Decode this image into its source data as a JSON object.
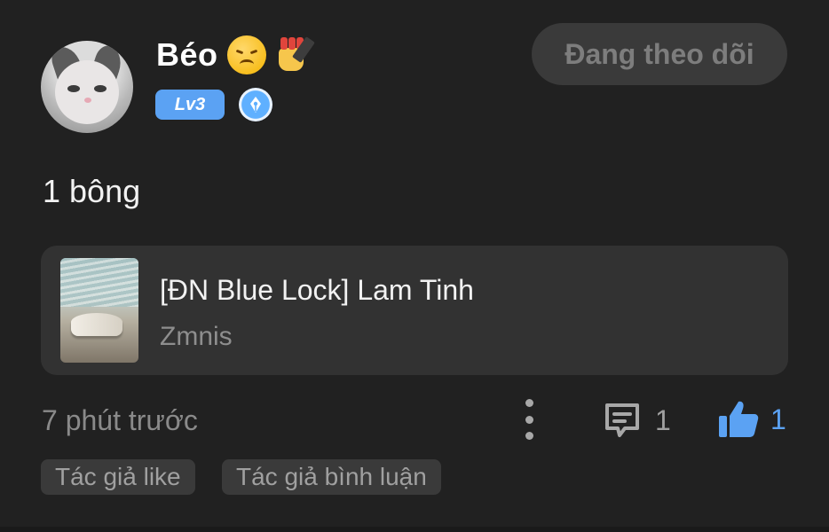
{
  "author": {
    "name": "Béo",
    "name_emojis": [
      "sad-face-emoji",
      "nail-polish-emoji"
    ],
    "level": "Lv3",
    "follow_button": "Đang theo dõi"
  },
  "post": {
    "text": "1 bông",
    "linked_book": {
      "title": "[ĐN Blue Lock] Lam Tinh",
      "author": "Zmnis"
    },
    "timestamp": "7 phút trước",
    "comment_count": "1",
    "like_count": "1",
    "tags": [
      "Tác giả like",
      "Tác giả bình luận"
    ]
  },
  "colors": {
    "background": "#212121",
    "card": "#323232",
    "accent_blue": "#5ba2f3",
    "muted_text": "#8a8a8a"
  }
}
